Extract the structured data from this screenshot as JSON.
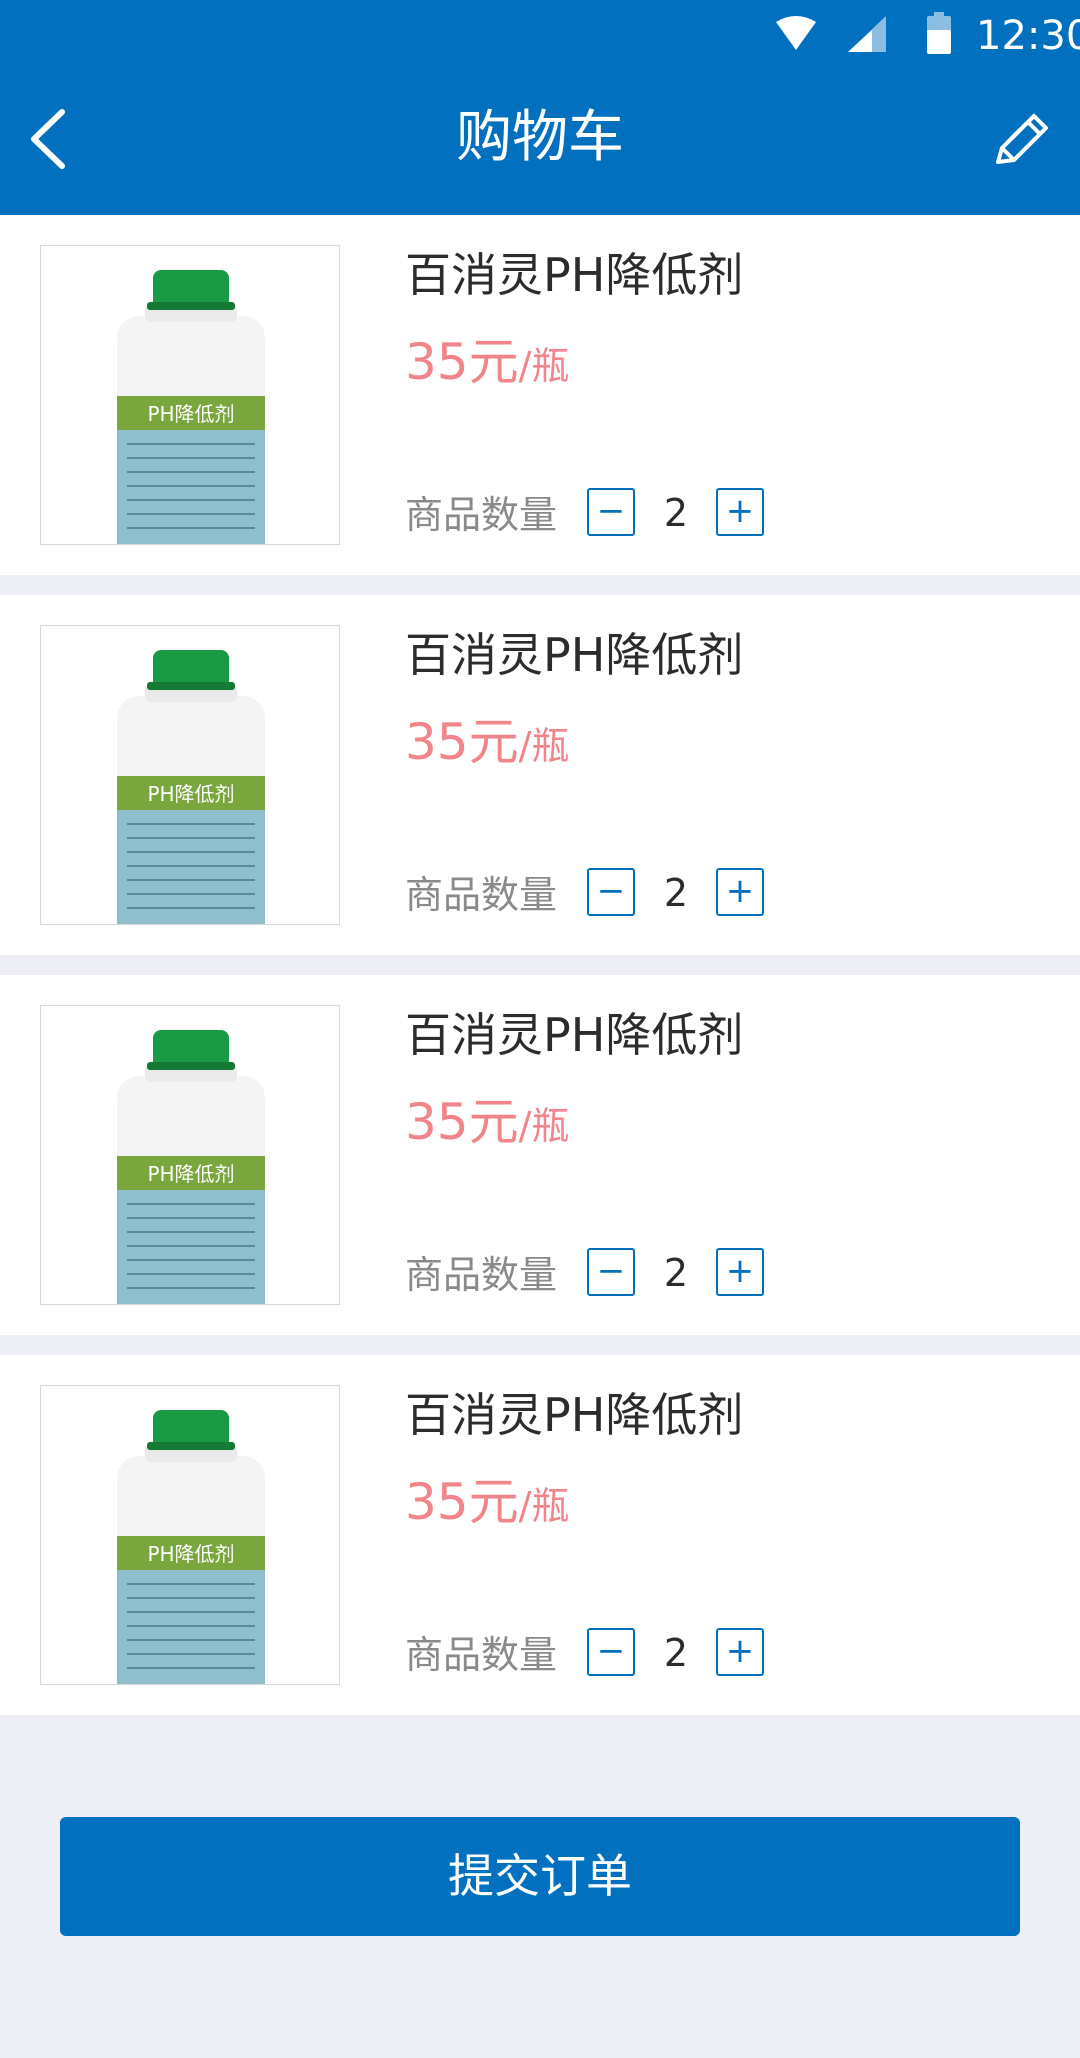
{
  "status_bar": {
    "time": "12:30",
    "icons": [
      "wifi-icon",
      "cell-signal-icon",
      "battery-icon"
    ]
  },
  "header": {
    "title": "购物车",
    "back_icon": "chevron-left-icon",
    "edit_icon": "pencil-icon"
  },
  "cart": {
    "items": [
      {
        "name": "百消灵PH降低剂",
        "price": "35元",
        "unit": "/瓶",
        "qty_label": "商品数量",
        "minus": "−",
        "plus": "+",
        "quantity": "2",
        "thumb_label": "PH降低剂"
      },
      {
        "name": "百消灵PH降低剂",
        "price": "35元",
        "unit": "/瓶",
        "qty_label": "商品数量",
        "minus": "−",
        "plus": "+",
        "quantity": "2",
        "thumb_label": "PH降低剂"
      },
      {
        "name": "百消灵PH降低剂",
        "price": "35元",
        "unit": "/瓶",
        "qty_label": "商品数量",
        "minus": "−",
        "plus": "+",
        "quantity": "2",
        "thumb_label": "PH降低剂"
      },
      {
        "name": "百消灵PH降低剂",
        "price": "35元",
        "unit": "/瓶",
        "qty_label": "商品数量",
        "minus": "−",
        "plus": "+",
        "quantity": "2",
        "thumb_label": "PH降低剂"
      }
    ]
  },
  "footer": {
    "submit_label": "提交订单"
  },
  "colors": {
    "primary": "#0070bf",
    "price": "#f2848a",
    "background": "#eeeef6"
  }
}
